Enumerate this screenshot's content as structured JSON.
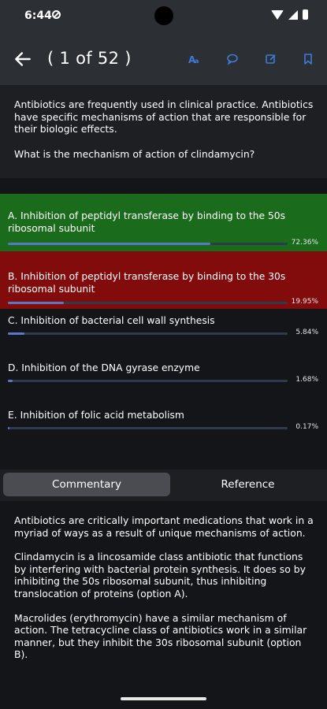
{
  "status": {
    "time": "6:44"
  },
  "header": {
    "title": "( 1 of 52 )",
    "accent": "#3d7bd8"
  },
  "question": {
    "stem": "Antibiotics are frequently used in clinical practice. Antibiotics have specific mechanisms of action that are responsible for their biologic effects.",
    "ask": "What is the mechanism of action of clindamycin?"
  },
  "options": [
    {
      "label": "A. Inhibition of peptidyl transferase by binding to the 50s ribosomal subunit",
      "percent": "72.36%",
      "value": 0.7236,
      "state": "correct",
      "bg": "#1b6b1c"
    },
    {
      "label": "B. Inhibition of peptidyl transferase by binding to the 30s ribosomal subunit",
      "percent": "19.95%",
      "value": 0.1995,
      "state": "incorrect",
      "bg": "#820c0c"
    },
    {
      "label": "C. Inhibition of bacterial cell wall synthesis",
      "percent": "5.84%",
      "value": 0.0584,
      "state": "neutral",
      "bg": "#141518"
    },
    {
      "label": "D. Inhibition of the DNA gyrase enzyme",
      "percent": "1.68%",
      "value": 0.0168,
      "state": "neutral",
      "bg": "#141518"
    },
    {
      "label": "E. Inhibition of folic acid metabolism",
      "percent": "0.17%",
      "value": 0.0017,
      "state": "neutral",
      "bg": "#141518"
    }
  ],
  "tabs": [
    {
      "label": "Commentary",
      "selected": true
    },
    {
      "label": "Reference",
      "selected": false
    }
  ],
  "commentary": [
    "Antibiotics are critically important medications that work in a myriad of ways as a result of unique mechanisms of action.",
    "Clindamycin is a lincosamide class antibiotic that functions by interfering with bacterial protein synthesis. It does so by inhibiting the 50s ribosomal subunit, thus inhibiting translocation of proteins (option A).",
    "Macrolides (erythromycin) have a similar mechanism of action. The tetracycline class of antibiotics work in a similar manner, but they inhibit the 30s ribosomal subunit (option B)."
  ]
}
